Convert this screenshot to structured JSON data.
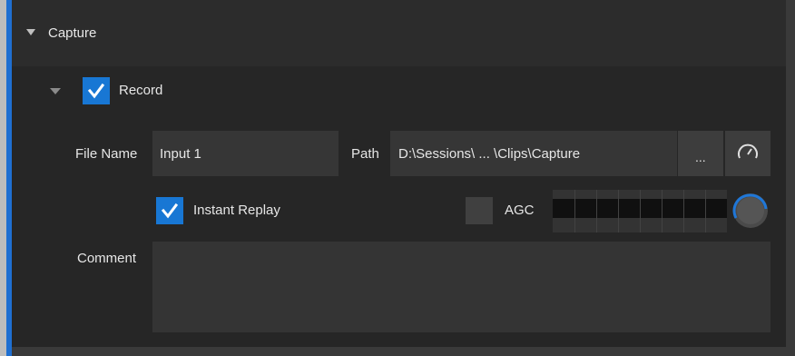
{
  "section": {
    "title": "Capture"
  },
  "record": {
    "label": "Record",
    "checked": true
  },
  "file_name": {
    "label": "File Name",
    "value": "Input 1"
  },
  "path": {
    "label": "Path",
    "value": "D:\\Sessions\\ ... \\Clips\\Capture",
    "browse_label": "...",
    "speed_icon": "speedometer-icon"
  },
  "instant_replay": {
    "label": "Instant Replay",
    "checked": true
  },
  "agc": {
    "label": "AGC",
    "checked": false
  },
  "audio_level_icon": "volume-knob-icon",
  "comment": {
    "label": "Comment",
    "value": ""
  },
  "colors": {
    "accent": "#1f6fd1",
    "checkbox": "#1877d4",
    "background": "#262626"
  }
}
